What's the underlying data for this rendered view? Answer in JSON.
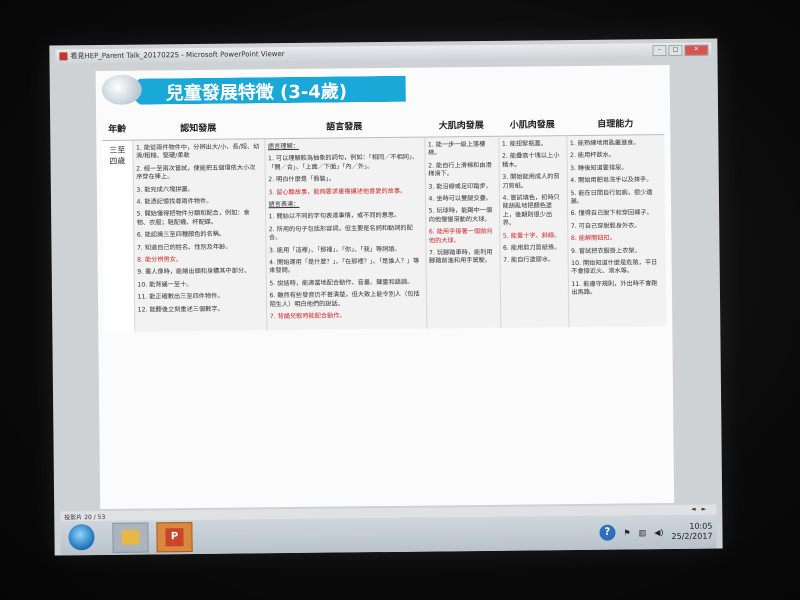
{
  "window": {
    "title": "看見HEP_Parent Talk_20170225 - Microsoft PowerPoint Viewer",
    "min": "–",
    "max": "□",
    "close": "✕"
  },
  "slide": {
    "title": "兒童發展特徵 (3-4歲)",
    "headers": [
      "年齡",
      "認知發展",
      "語言發展",
      "大肌肉發展",
      "小肌肉發展",
      "自理能力"
    ],
    "age": "三至四歲",
    "cognitive": [
      "1. 能從兩件物件中，分辨出大/小、長/短、幼滑/粗糙、堅硬/柔軟",
      "2. 經一至兩次嘗試，便能把五個環依大小次序穿在棒上。",
      "3. 能完成六塊拼圖。",
      "4. 能憑記憶找尋兩件物件。",
      "5. 開始懂得把物件分類和配合，例如：食物、衣服；鞋配襪、杯配碟。",
      "6. 能認識三至四種顏色的名稱。",
      "7. 知道自己的姓名、性別及年齡。",
      "8. 能分辨男女。",
      "9. 畫人像時，能繪出頭和身體其中部分。",
      "10. 能背誦一至十。",
      "11. 能正確數出三至四件物件。",
      "12. 能聽後立刻重述三個數字。"
    ],
    "language_understanding_label": "語言理解：",
    "language_understanding": [
      "1. 可以理解較為抽象的詞句，例如：「相同／不相同」、「開／合」、「上面／下面」「內／外」。",
      "2. 明白什麼是「假裝」。",
      "3. 留心聽故事，能夠要求重複講述他喜愛的故事。"
    ],
    "language_expression_label": "語言表達：",
    "language_expression": [
      "1. 開始以不同的字句表達事情，或不同的意思。",
      "2. 所用的句子包括形容詞，但主要是名詞和動詞的配合。",
      "3. 能用「這裡」、「那裡」、「你」、「我」等詞語。",
      "4. 開始運用「是什麼？」、「在那裡？」、「是誰人？」等來發問。",
      "5. 說話時，能適當地配合動作、音量、聲量和語調。",
      "6. 雖然有些發音仍不甚清楚，但大致上能令別人（包括陌生人）明白他們的說話。",
      "7. 背誦兒歌時能配合動作。"
    ],
    "gross_motor": [
      "1. 能一步一級上落樓梯。",
      "2. 能自行上滑梯和由滑梯滑下。",
      "3. 能沿線或足印踏步。",
      "4. 坐時可以雙腿交疊。",
      "5. 玩球時，能踢中一個向他慢慢滾動的大球。",
      "6. 能用手接著一個拋向他的大球。",
      "7. 玩腳踏車時，能利用腳踏前進和用手駕駛。"
    ],
    "fine_motor": [
      "1. 能扭緊瓶蓋。",
      "2. 能疊高十塊以上小積木。",
      "3. 開始能用成人的剪刀剪紙。",
      "4. 嘗試填色，初時只能胡亂地把顏色塗上，後期則很少出界。",
      "5. 能畫十字、斜線。",
      "6. 能用剪刀剪紙條。",
      "7. 能自行塗膠水。"
    ],
    "self_care": [
      "1. 能熟練地用匙羹進食。",
      "2. 能用杯飲水。",
      "3. 睡後知道要排尿。",
      "4. 開始用肥皂洗手以及抹手。",
      "5. 能在日間自行如廁，很少遺漏。",
      "6. 懂得自己脫下和穿回褲子。",
      "7. 可自己穿脫鬆身外衣。",
      "8. 能解開鈕扣。",
      "9. 嘗試把衣服掛上衣架。",
      "10. 開始知道什麼是危險，平日不會接近火、滾水等。",
      "11. 能遵守規則，外出時不會跑出馬路。"
    ]
  },
  "status": {
    "slide_counter": "投影片 20 / 53",
    "prev": "◄",
    "next": "►"
  },
  "taskbar": {
    "powerpoint_glyph": "P",
    "help_glyph": "?",
    "time": "10:05",
    "date": "25/2/2017"
  }
}
